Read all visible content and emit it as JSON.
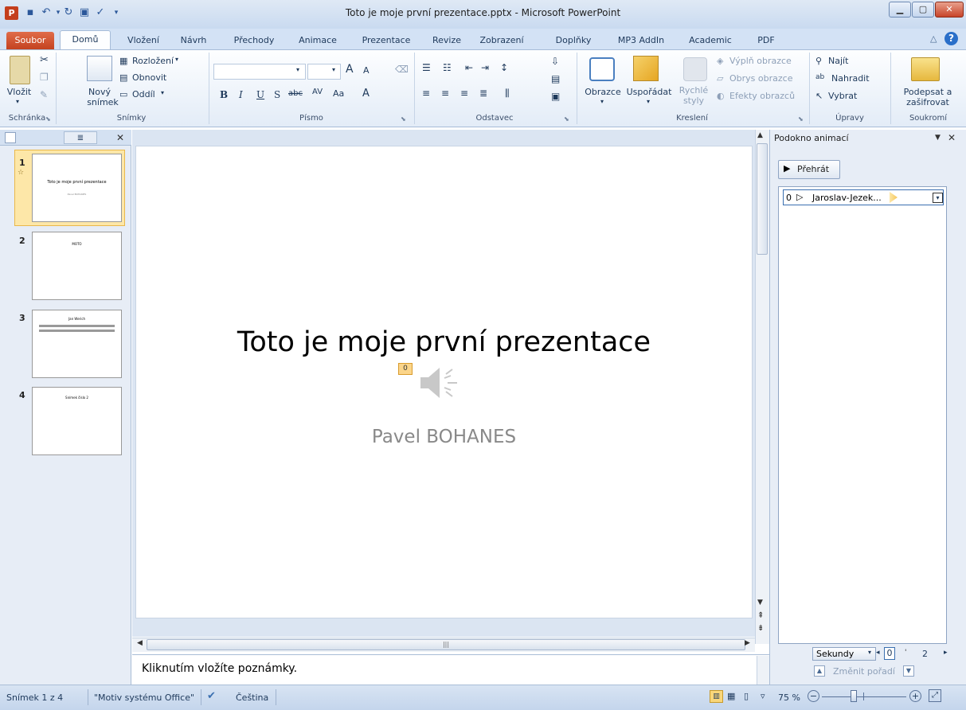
{
  "window": {
    "title": "Toto je moje první prezentace.pptx - Microsoft PowerPoint",
    "app_icon": "P"
  },
  "tabs": [
    "Soubor",
    "Domů",
    "Vložení",
    "Návrh",
    "Přechody",
    "Animace",
    "Prezentace",
    "Revize",
    "Zobrazení",
    "Doplňky",
    "MP3 AddIn",
    "Academic",
    "PDF"
  ],
  "ribbon": {
    "clipboard": {
      "paste": "Vložit",
      "label": "Schránka"
    },
    "slides": {
      "new_slide_line1": "Nový",
      "new_slide_line2": "snímek",
      "layout": "Rozložení",
      "reset": "Obnovit",
      "section": "Oddíl",
      "label": "Snímky"
    },
    "font": {
      "label": "Písmo"
    },
    "paragraph": {
      "label": "Odstavec"
    },
    "drawing": {
      "shapes": "Obrazce",
      "arrange": "Uspořádat",
      "quick_styles_1": "Rychlé",
      "quick_styles_2": "styly",
      "fill": "Výplň obrazce",
      "outline": "Obrys obrazce",
      "effects": "Efekty obrazců",
      "label": "Kreslení"
    },
    "editing": {
      "find": "Najít",
      "replace": "Nahradit",
      "select": "Vybrat",
      "label": "Úpravy"
    },
    "privacy": {
      "sign_1": "Podepsat a",
      "sign_2": "zašifrovat",
      "label": "Soukromí"
    }
  },
  "thumbnails": [
    {
      "num": "1",
      "title": "Toto je moje první prezentace",
      "sub": "Pavel BOHANES"
    },
    {
      "num": "2",
      "title": "MOTO"
    },
    {
      "num": "3",
      "title": "Jan Werich"
    },
    {
      "num": "4",
      "title": "Snímek číslo 2"
    }
  ],
  "slide": {
    "title": "Toto je moje první prezentace",
    "subtitle": "Pavel BOHANES",
    "anim_tag": "0"
  },
  "notes": {
    "placeholder": "Kliknutím vložíte poznámky."
  },
  "anim_pane": {
    "title": "Podokno animací",
    "play": "Přehrát",
    "item_num": "0",
    "item_name": "Jaroslav-Jezek...",
    "seconds": "Sekundy",
    "timeline_0": "0",
    "timeline_2": "2",
    "reorder": "Změnit pořadí"
  },
  "status": {
    "slide": "Snímek 1 z 4",
    "theme": "\"Motiv systému Office\"",
    "language": "Čeština",
    "zoom": "75 %"
  }
}
